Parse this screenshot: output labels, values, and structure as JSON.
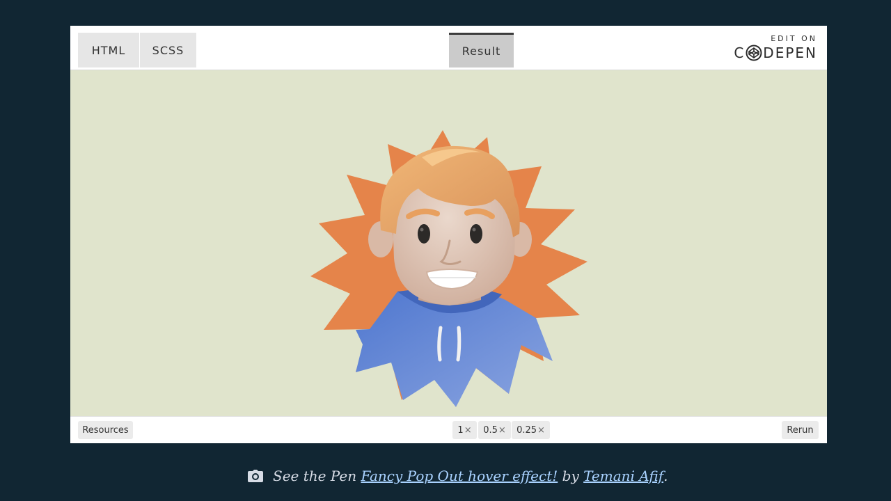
{
  "topbar": {
    "tabs": [
      {
        "label": "HTML"
      },
      {
        "label": "SCSS"
      },
      {
        "label": "Result",
        "active": true
      }
    ],
    "brand_top": "EDIT ON",
    "brand_left": "C",
    "brand_right": "DEPEN"
  },
  "stage": {
    "background": "#e0e4cc",
    "illustration": {
      "icon": "avatar-illustration",
      "burst_color": "#e5844a",
      "hoodie_color": "#5e86d2"
    }
  },
  "bottombar": {
    "resources_label": "Resources",
    "zoom_options": [
      "1",
      "0.5",
      "0.25"
    ],
    "zoom_symbol": "×",
    "rerun_label": "Rerun"
  },
  "caption": {
    "icon": "camera-icon",
    "prefix": "See the Pen",
    "pen_title": "Fancy Pop Out hover effect!",
    "by": "by",
    "author": "Temani Afif",
    "suffix": "."
  },
  "colors": {
    "page_background": "#112633",
    "link": "#a9d2ff"
  }
}
